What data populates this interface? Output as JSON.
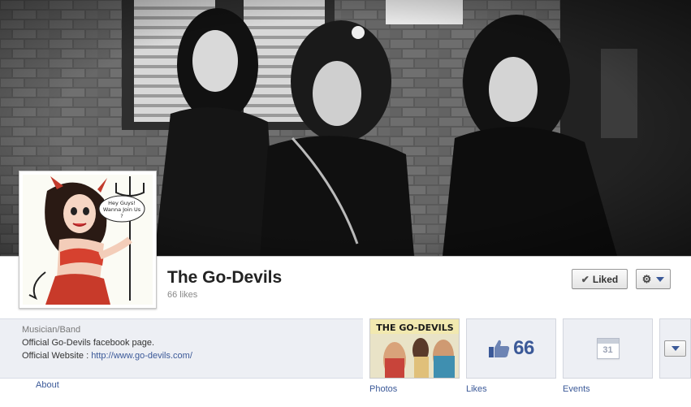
{
  "page": {
    "name": "The Go-Devils",
    "likes_text": "66 likes"
  },
  "actions": {
    "liked_label": "Liked",
    "check_glyph": "✔",
    "gear_glyph": "⚙"
  },
  "about": {
    "category": "Musician/Band",
    "line1": "Official Go-Devils facebook page.",
    "website_prefix": "Official Website : ",
    "website_url": "http://www.go-devils.com/",
    "about_link": "About"
  },
  "profile_art": {
    "speech_line1": "Hey Guys!",
    "speech_line2": "Wanna Join Us",
    "speech_line3": "?"
  },
  "apps": {
    "photos_label": "Photos",
    "photos_banner": "THE GO-DEVILS",
    "likes_count": "66",
    "likes_label": "Likes",
    "events_label": "Events",
    "events_day": "31"
  },
  "colors": {
    "link": "#3b5998",
    "info_bg": "#edeff4"
  },
  "icons": [
    "check-icon",
    "gear-icon",
    "chevron-down-icon",
    "thumbs-up-icon",
    "calendar-icon"
  ]
}
